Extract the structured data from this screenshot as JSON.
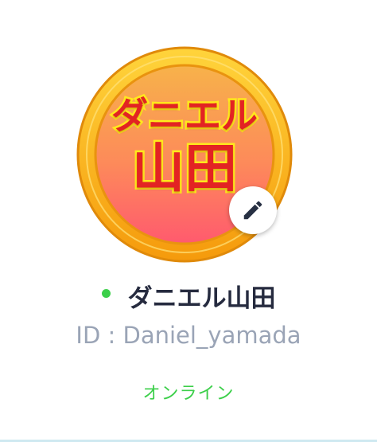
{
  "profile": {
    "avatar": {
      "line1": "ダニエル",
      "line2": "山田",
      "ring_color": "#f9b51c",
      "inner_gradient_top": "#f7b24a",
      "inner_gradient_bottom": "#ff5a6e",
      "text_color": "#e32323",
      "text_outline_color": "#ffe91c"
    },
    "edit_icon": "pencil-icon",
    "display_name": "ダニエル山田",
    "user_id": "ID : Daniel_yamada",
    "status": "オンライン",
    "status_color": "#3ccf4a"
  }
}
